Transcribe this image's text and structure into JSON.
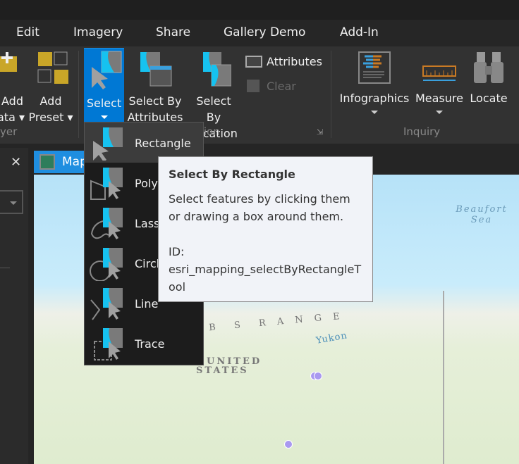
{
  "tabs": [
    "Edit",
    "Imagery",
    "Share",
    "Gallery Demo",
    "Add-In"
  ],
  "ribbon": {
    "add_data": "Add\nData",
    "add_data_l1": "Add",
    "add_data_l2": "ata",
    "add_preset_l1": "Add",
    "add_preset_l2": "Preset",
    "layer_group": "yer",
    "select": "Select",
    "select_by_attr_l1": "Select By",
    "select_by_attr_l2": "Attributes",
    "select_by_loc_l1": "Select By",
    "select_by_loc_l2": "Location",
    "attributes": "Attributes",
    "clear": "Clear",
    "selection_group": "tion",
    "infographics": "Infographics",
    "measure": "Measure",
    "locate": "Locate",
    "inquiry_group": "Inquiry"
  },
  "map_tab": "Map",
  "select_menu": [
    "Rectangle",
    "Polygon",
    "Lasso",
    "Circle",
    "Line",
    "Trace"
  ],
  "select_menu_visible": [
    "Rectangle",
    "Poly",
    "Lass",
    "Circl",
    "Line",
    "Trace"
  ],
  "tooltip": {
    "title": "Select By Rectangle",
    "desc": "Select features by clicking them or drawing a box around them.",
    "id_label": "ID:",
    "id_value": "esri_mapping_selectByRectangleTool"
  },
  "map_labels": {
    "sea": "Beaufort Sea",
    "range": "B  S  R A N G E",
    "country_l1": "UNITED",
    "country_l2": "STATES",
    "river": "Yukon"
  },
  "colors": {
    "accent": "#1f8ee0",
    "select_blue": "#0078d4"
  }
}
